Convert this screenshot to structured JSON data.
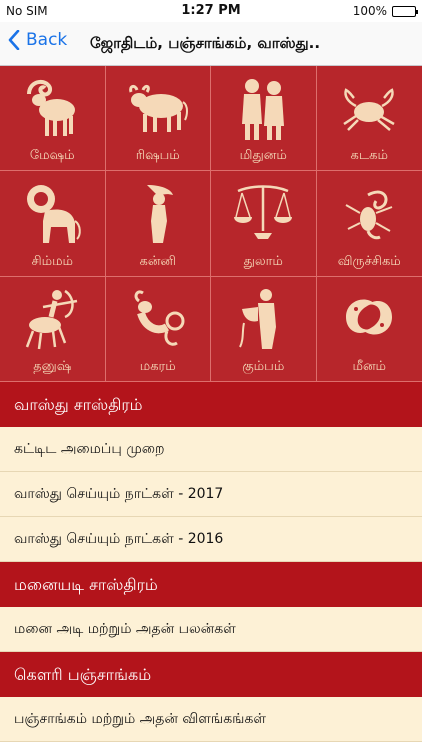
{
  "status": {
    "carrier": "No SIM",
    "time": "1:27 PM",
    "battery": "100%"
  },
  "nav": {
    "back_label": "Back",
    "title": "ஜோதிடம், பஞ்சாங்கம், வாஸ்து.."
  },
  "zodiac": [
    {
      "label": "மேஷம்",
      "icon": "ram-icon"
    },
    {
      "label": "ரிஷபம்",
      "icon": "bull-icon"
    },
    {
      "label": "மிதுனம்",
      "icon": "twins-icon"
    },
    {
      "label": "கடகம்",
      "icon": "crab-icon"
    },
    {
      "label": "சிம்மம்",
      "icon": "lion-icon"
    },
    {
      "label": "கன்னி",
      "icon": "virgin-icon"
    },
    {
      "label": "துலாம்",
      "icon": "scales-icon"
    },
    {
      "label": "விருச்சிகம்",
      "icon": "scorpion-icon"
    },
    {
      "label": "தனுஷ்",
      "icon": "archer-icon"
    },
    {
      "label": "மகரம்",
      "icon": "goat-fish-icon"
    },
    {
      "label": "கும்பம்",
      "icon": "water-bearer-icon"
    },
    {
      "label": "மீனம்",
      "icon": "fish-icon"
    }
  ],
  "sections": [
    {
      "header": "வாஸ்து சாஸ்திரம்",
      "items": [
        "கட்டிட அமைப்பு முறை",
        "வாஸ்து செய்யும் நாட்கள் - 2017",
        "வாஸ்து செய்யும் நாட்கள் - 2016"
      ]
    },
    {
      "header": "மனையடி சாஸ்திரம்",
      "items": [
        "மனை அடி மற்றும் அதன் பலன்கள்"
      ]
    },
    {
      "header": "கௌரி பஞ்சாங்கம்",
      "items": [
        "பஞ்சாங்கம் மற்றும் அதன் விளங்கங்கள்"
      ]
    }
  ],
  "colors": {
    "grid_bg": "#b7262b",
    "icon": "#f5d9b8",
    "section_bg": "#b3141b",
    "row_bg": "#fdf1d6",
    "accent": "#1a73e8"
  }
}
